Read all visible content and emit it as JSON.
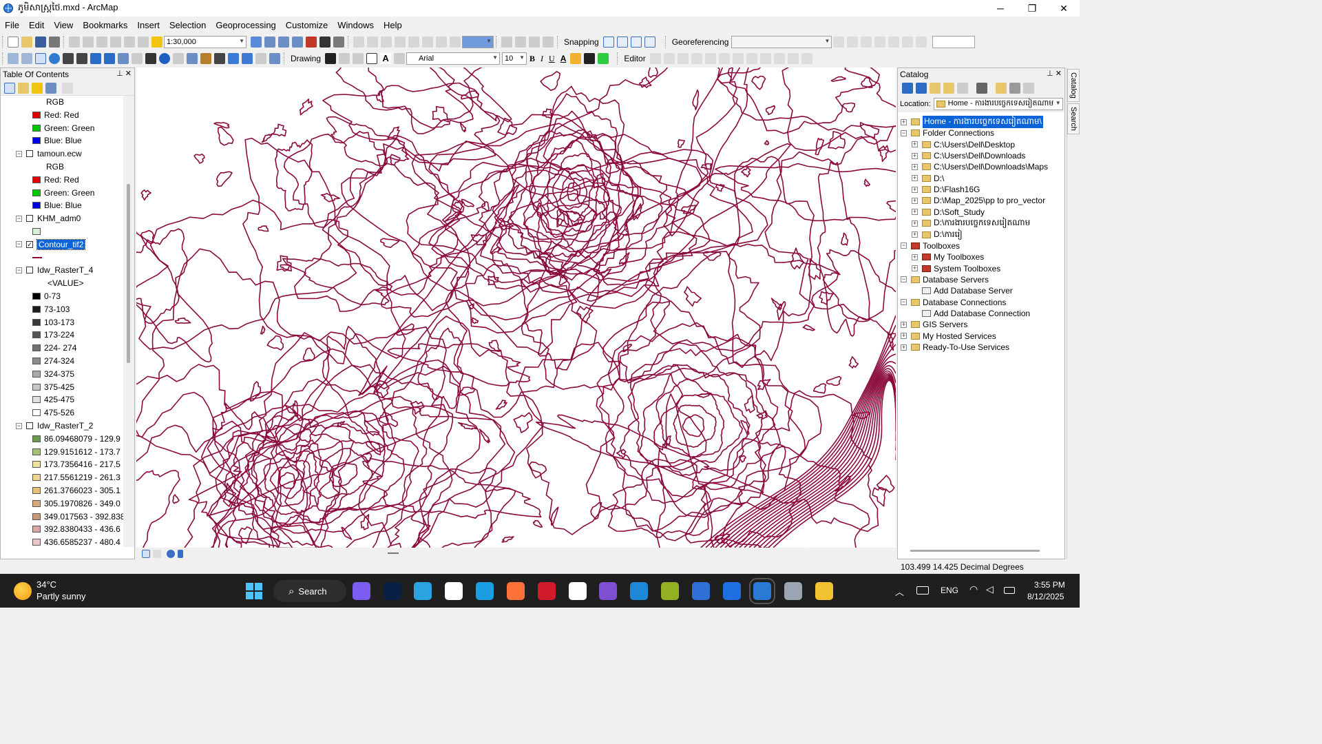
{
  "window": {
    "title": "ភូមិសាស្ត្រថៃ.mxd - ArcMap",
    "controls": [
      "─",
      "❐",
      "✕"
    ]
  },
  "menu": [
    "File",
    "Edit",
    "View",
    "Bookmarks",
    "Insert",
    "Selection",
    "Geoprocessing",
    "Customize",
    "Windows",
    "Help"
  ],
  "standard_toolbar": {
    "scale": "1:30,000",
    "snapping_label": "Snapping",
    "georeferencing_label": "Georeferencing"
  },
  "draw_toolbar": {
    "drawing_label": "Drawing",
    "font": "Arial",
    "font_size": "10",
    "bold": "B",
    "italic": "I",
    "underline": "U",
    "text_color_glyph": "A",
    "editor_label": "Editor"
  },
  "toc": {
    "title": "Table Of Contents",
    "rows": [
      {
        "kind": "label",
        "text": "RGB",
        "indent": 66
      },
      {
        "kind": "swatch",
        "color": "#e00000",
        "text": "Red:   Red",
        "indent": 46
      },
      {
        "kind": "swatch",
        "color": "#00c800",
        "text": "Green: Green",
        "indent": 46
      },
      {
        "kind": "swatch",
        "color": "#0000e6",
        "text": "Blue:  Blue",
        "indent": 46
      },
      {
        "kind": "layer",
        "text": "tamoun.ecw",
        "checked": false,
        "indent": 22
      },
      {
        "kind": "label",
        "text": "RGB",
        "indent": 66
      },
      {
        "kind": "swatch",
        "color": "#e00000",
        "text": "Red:   Red",
        "indent": 46
      },
      {
        "kind": "swatch",
        "color": "#00c800",
        "text": "Green: Green",
        "indent": 46
      },
      {
        "kind": "swatch",
        "color": "#0000e6",
        "text": "Blue:  Blue",
        "indent": 46
      },
      {
        "kind": "layer",
        "text": "KHM_adm0",
        "checked": false,
        "indent": 22
      },
      {
        "kind": "swatch",
        "color": "#d6f0d6",
        "text": "",
        "indent": 46
      },
      {
        "kind": "layer",
        "text": "Contour_tif2",
        "checked": true,
        "selected": true,
        "indent": 22
      },
      {
        "kind": "line",
        "color": "#8b0a3c",
        "text": "",
        "indent": 46
      },
      {
        "kind": "layer",
        "text": "Idw_RasterT_4",
        "checked": false,
        "indent": 22
      },
      {
        "kind": "label",
        "text": "<VALUE>",
        "indent": 68
      },
      {
        "kind": "swatch",
        "color": "#000000",
        "text": "0-73",
        "indent": 46
      },
      {
        "kind": "swatch",
        "color": "#1c1c1c",
        "text": "73-103",
        "indent": 46
      },
      {
        "kind": "swatch",
        "color": "#383838",
        "text": "103-173",
        "indent": 46
      },
      {
        "kind": "swatch",
        "color": "#555555",
        "text": "173-224",
        "indent": 46
      },
      {
        "kind": "swatch",
        "color": "#717171",
        "text": "224- 274",
        "indent": 46
      },
      {
        "kind": "swatch",
        "color": "#8d8d8d",
        "text": "274-324",
        "indent": 46
      },
      {
        "kind": "swatch",
        "color": "#aaaaaa",
        "text": "324-375",
        "indent": 46
      },
      {
        "kind": "swatch",
        "color": "#c6c6c6",
        "text": "375-425",
        "indent": 46
      },
      {
        "kind": "swatch",
        "color": "#e2e2e2",
        "text": "425-475",
        "indent": 46
      },
      {
        "kind": "swatch",
        "color": "#ffffff",
        "text": "475-526",
        "indent": 46
      },
      {
        "kind": "layer",
        "text": "Idw_RasterT_2",
        "checked": false,
        "indent": 22
      },
      {
        "kind": "swatch",
        "color": "#6f9a4e",
        "text": "86.09468079 - 129.9",
        "indent": 46
      },
      {
        "kind": "swatch",
        "color": "#a4c27a",
        "text": "129.9151612 - 173.7",
        "indent": 46
      },
      {
        "kind": "swatch",
        "color": "#eee3a0",
        "text": "173.7356416 - 217.5",
        "indent": 46
      },
      {
        "kind": "swatch",
        "color": "#f0d58f",
        "text": "217.5561219 - 261.3",
        "indent": 46
      },
      {
        "kind": "swatch",
        "color": "#e6bf7a",
        "text": "261.3766023 - 305.1",
        "indent": 46
      },
      {
        "kind": "swatch",
        "color": "#d9a97a",
        "text": "305.1970826 - 349.0",
        "indent": 46
      },
      {
        "kind": "swatch",
        "color": "#c9977c",
        "text": "349.017563 - 392.838",
        "indent": 46
      },
      {
        "kind": "swatch",
        "color": "#d6a9a5",
        "text": "392.8380433 - 436.6",
        "indent": 46
      },
      {
        "kind": "swatch",
        "color": "#e9c8c8",
        "text": "436.6585237 - 480.4",
        "indent": 46
      }
    ]
  },
  "catalog": {
    "title": "Catalog",
    "location_label": "Location:",
    "location_value": "Home - ការងារបច្ចេកទេសរៀតណាម",
    "tree": [
      {
        "text": "Home - ការងារបច្ចេកទេសរៀតណាម\\",
        "level": 0,
        "exp": "+",
        "icon": "folder",
        "selected": true
      },
      {
        "text": "Folder Connections",
        "level": 0,
        "exp": "−",
        "icon": "folder"
      },
      {
        "text": "C:\\Users\\Dell\\Desktop",
        "level": 1,
        "exp": "+",
        "icon": "folder"
      },
      {
        "text": "C:\\Users\\Dell\\Downloads",
        "level": 1,
        "exp": "+",
        "icon": "folder"
      },
      {
        "text": "C:\\Users\\Dell\\Downloads\\Maps",
        "level": 1,
        "exp": "+",
        "icon": "folder"
      },
      {
        "text": "D:\\",
        "level": 1,
        "exp": "+",
        "icon": "folder"
      },
      {
        "text": "D:\\Flash16G",
        "level": 1,
        "exp": "+",
        "icon": "folder"
      },
      {
        "text": "D:\\Map_2025\\pp to pro_vector",
        "level": 1,
        "exp": "+",
        "icon": "folder"
      },
      {
        "text": "D:\\Soft_Study",
        "level": 1,
        "exp": "+",
        "icon": "folder"
      },
      {
        "text": "D:\\ការងារបច្ចេកទេសរៀតណាម",
        "level": 1,
        "exp": "+",
        "icon": "folder"
      },
      {
        "text": "D:\\ការរៀ",
        "level": 1,
        "exp": "+",
        "icon": "folder"
      },
      {
        "text": "Toolboxes",
        "level": 0,
        "exp": "−",
        "icon": "red"
      },
      {
        "text": "My Toolboxes",
        "level": 1,
        "exp": "+",
        "icon": "red"
      },
      {
        "text": "System Toolboxes",
        "level": 1,
        "exp": "+",
        "icon": "red"
      },
      {
        "text": "Database Servers",
        "level": 0,
        "exp": "−",
        "icon": "folder"
      },
      {
        "text": "Add Database Server",
        "level": 1,
        "exp": "",
        "icon": "add"
      },
      {
        "text": "Database Connections",
        "level": 0,
        "exp": "−",
        "icon": "folder"
      },
      {
        "text": "Add Database Connection",
        "level": 1,
        "exp": "",
        "icon": "add"
      },
      {
        "text": "GIS Servers",
        "level": 0,
        "exp": "+",
        "icon": "folder"
      },
      {
        "text": "My Hosted Services",
        "level": 0,
        "exp": "+",
        "icon": "folder"
      },
      {
        "text": "Ready-To-Use Services",
        "level": 0,
        "exp": "+",
        "icon": "folder"
      }
    ],
    "side_tabs": [
      "Catalog",
      "Search"
    ]
  },
  "status": {
    "coordinates": "103.499  14.425 Decimal Degrees"
  },
  "taskbar": {
    "weather_temp": "34°C",
    "weather_desc": "Partly sunny",
    "search_label": "Search",
    "language": "ENG",
    "time": "3:55 PM",
    "date": "8/12/2025",
    "apps": [
      {
        "name": "copilot",
        "color": "#7b5cf0"
      },
      {
        "name": "photoshop",
        "color": "#0a1f44"
      },
      {
        "name": "telegram",
        "color": "#2aa3e0"
      },
      {
        "name": "store",
        "color": "#ffffff"
      },
      {
        "name": "edge",
        "color": "#1b9de2"
      },
      {
        "name": "firefox",
        "color": "#ff7139"
      },
      {
        "name": "screen-recorder",
        "color": "#d11a2a"
      },
      {
        "name": "inkscape",
        "color": "#ffffff"
      },
      {
        "name": "visual-studio",
        "color": "#7f4fd1"
      },
      {
        "name": "vscode",
        "color": "#1e88d8"
      },
      {
        "name": "qgis",
        "color": "#93b023"
      },
      {
        "name": "app-s",
        "color": "#2e6fd8"
      },
      {
        "name": "app-shield",
        "color": "#1f6fe0"
      },
      {
        "name": "arcmap",
        "color": "#2a7ad4"
      },
      {
        "name": "globe",
        "color": "#9aa5b1"
      },
      {
        "name": "file-explorer",
        "color": "#f2c230"
      }
    ]
  },
  "colors": {
    "contour": "#8b0a3c",
    "selection": "#0a64d8",
    "taskbar": "#1f1f1f"
  }
}
